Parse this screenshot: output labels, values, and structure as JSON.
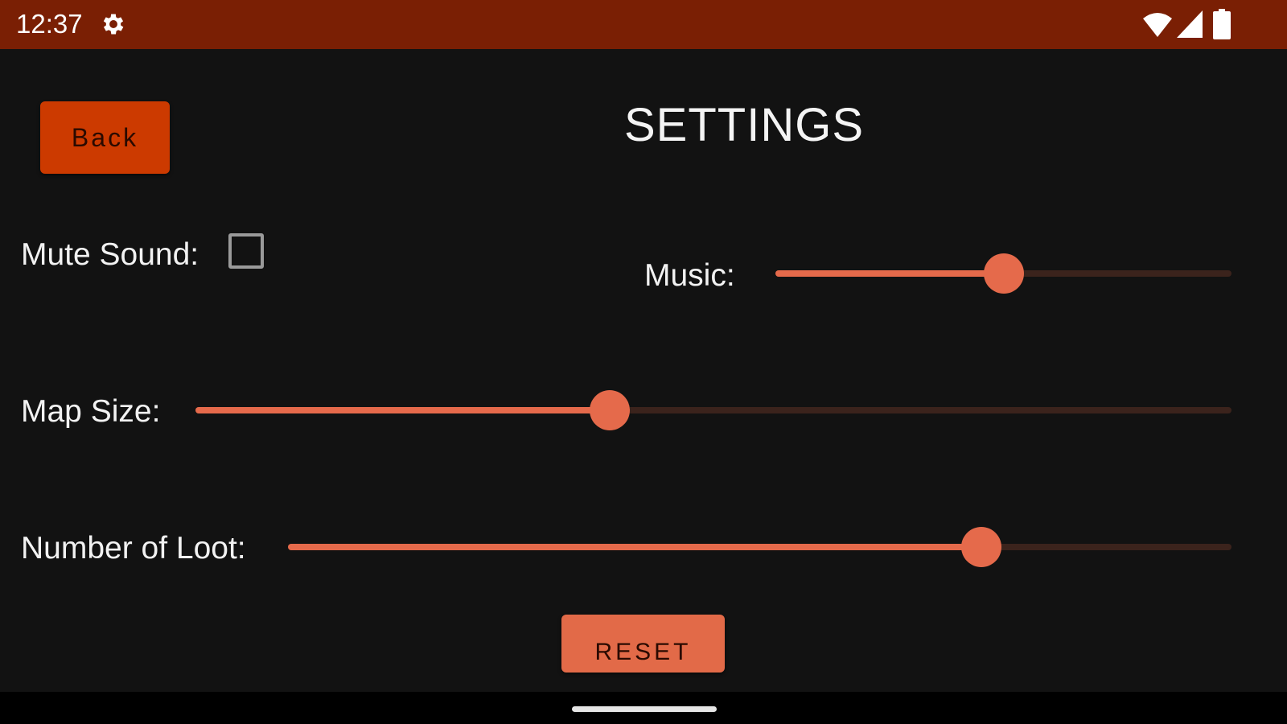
{
  "status_bar": {
    "time": "12:37",
    "icons": [
      "gear-icon",
      "wifi-icon",
      "signal-icon",
      "battery-icon"
    ],
    "background": "#7a1f04"
  },
  "header": {
    "back_label": "Back",
    "title": "SETTINGS"
  },
  "settings": {
    "mute_label": "Mute Sound:",
    "mute_checked": false,
    "music_label": "Music:",
    "music_value": 0.5,
    "map_size_label": "Map Size:",
    "map_size_value": 0.4,
    "loot_label": "Number of Loot:",
    "loot_value": 0.735
  },
  "footer": {
    "reset_label": "RESET"
  },
  "colors": {
    "accent": "#e56a4b",
    "back_button": "#cc3a00",
    "track": "#3b231c",
    "background": "#121212"
  }
}
